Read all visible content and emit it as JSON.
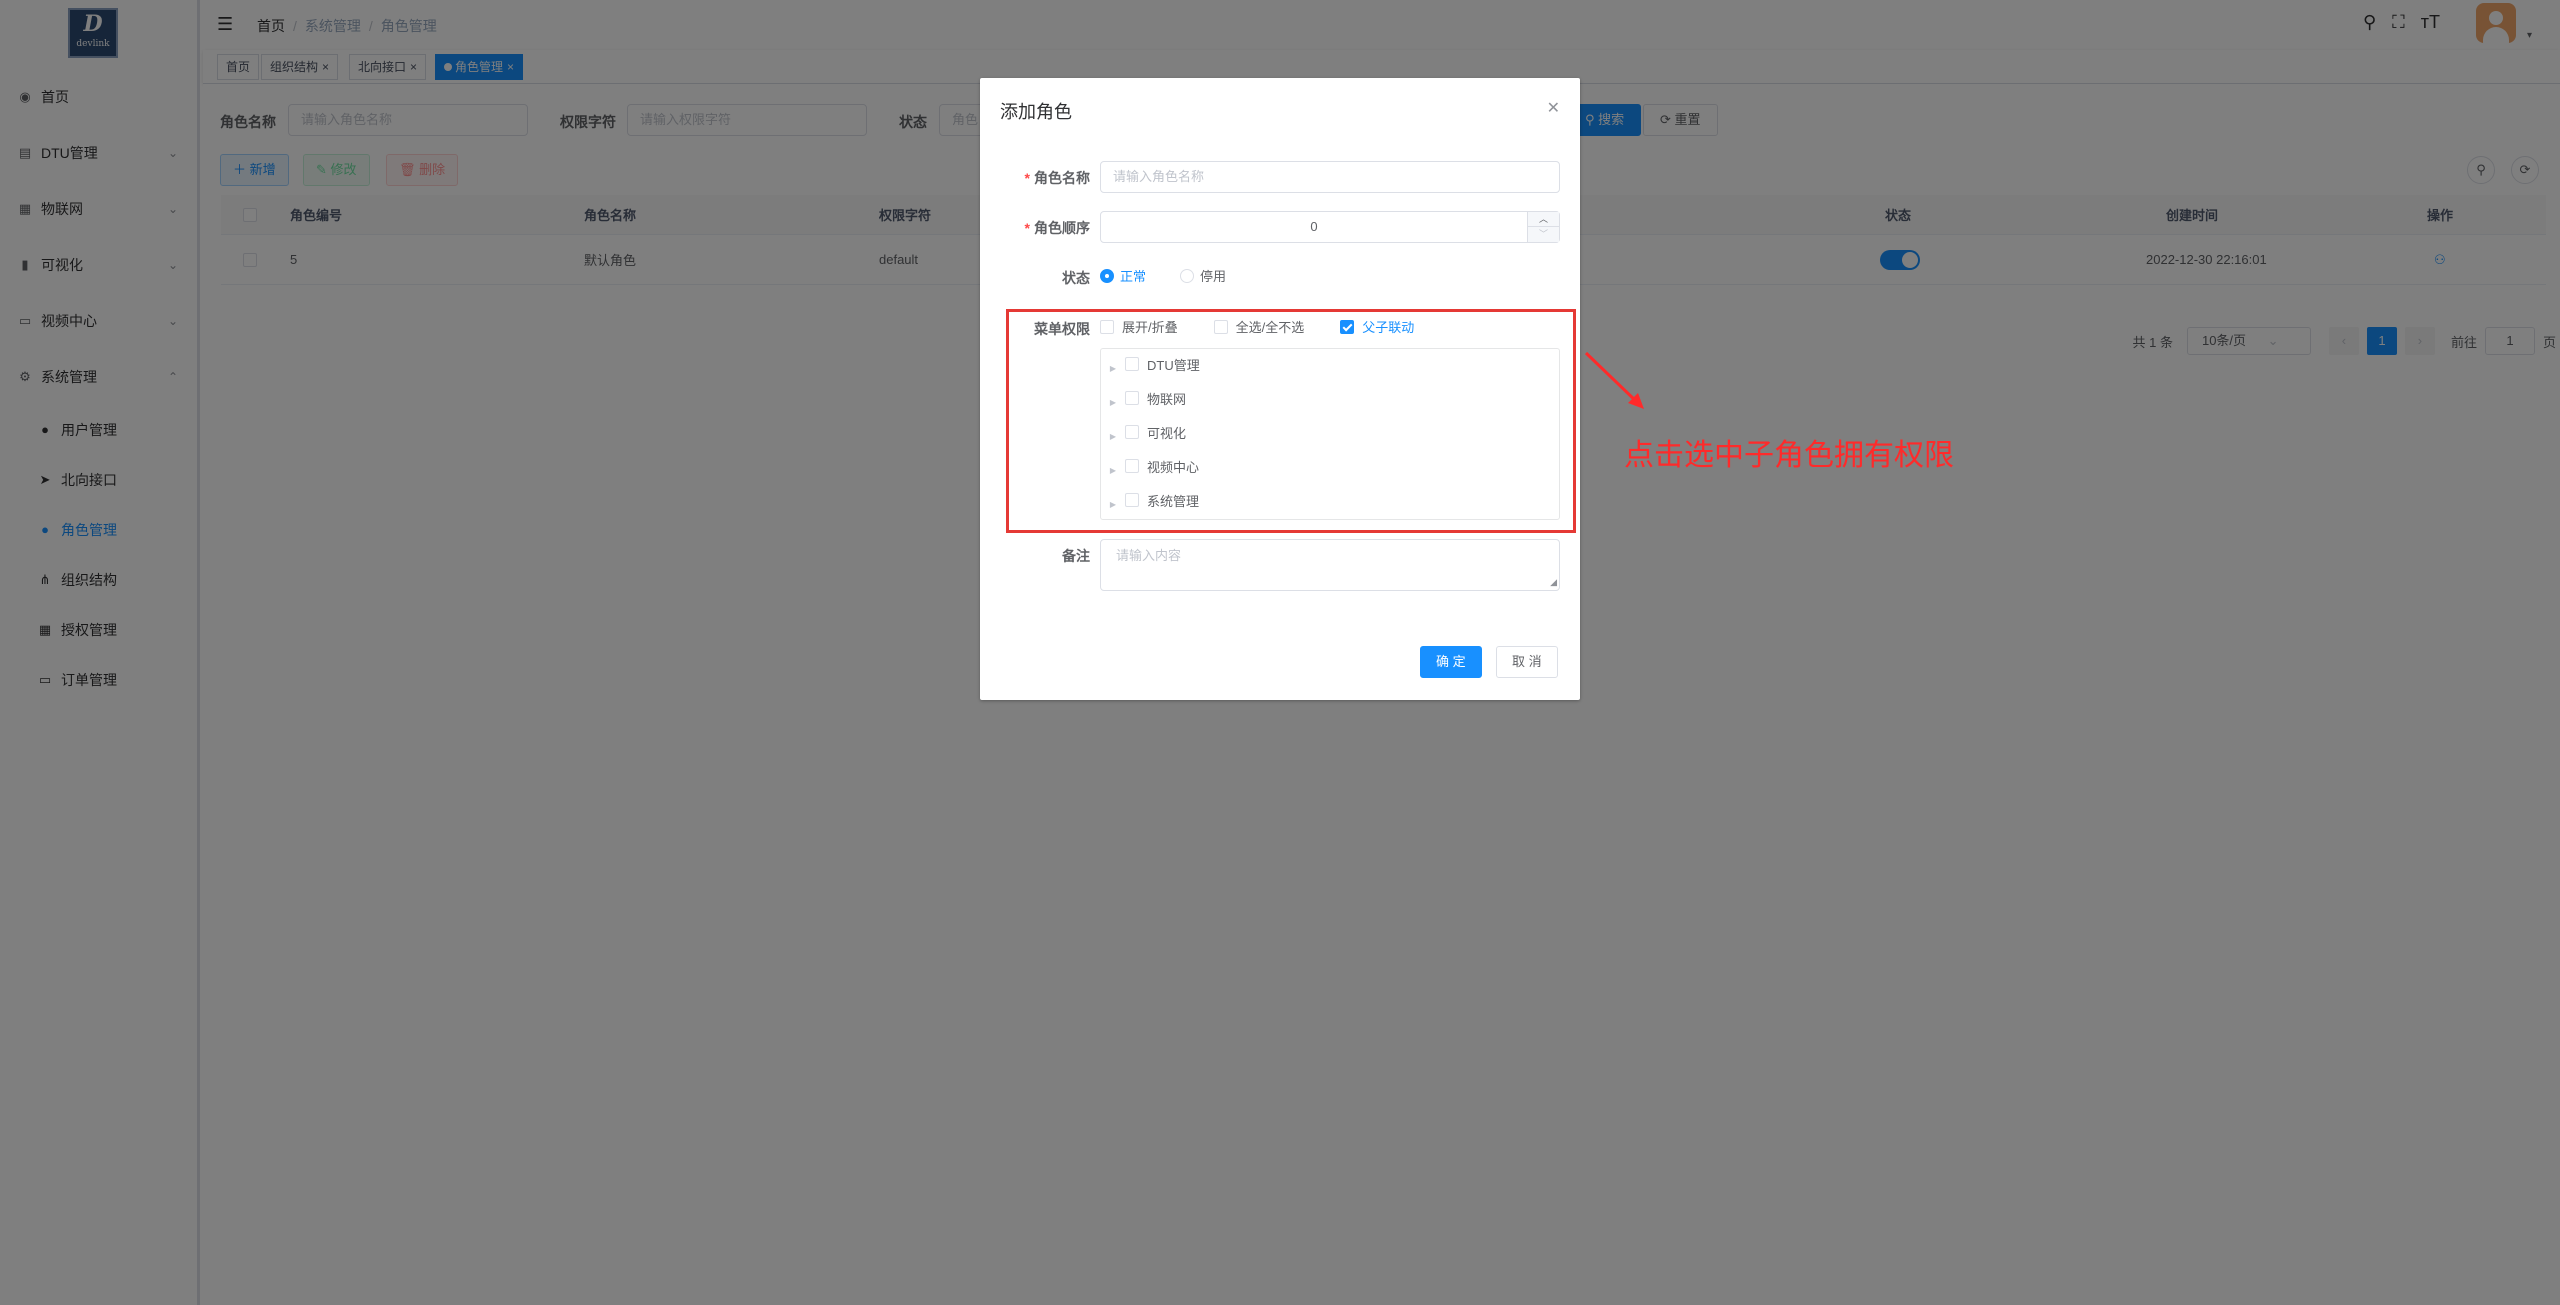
{
  "logo": {
    "big": "D",
    "small": "devlink"
  },
  "sidebar": {
    "items": [
      {
        "label": "首页",
        "icon": "dashboard-icon",
        "glyph": "◉"
      },
      {
        "label": "DTU管理",
        "icon": "dtu-icon",
        "glyph": "▤"
      },
      {
        "label": "物联网",
        "icon": "iot-icon",
        "glyph": "▦"
      },
      {
        "label": "可视化",
        "icon": "chart-icon",
        "glyph": "▮"
      },
      {
        "label": "视频中心",
        "icon": "monitor-icon",
        "glyph": "▭"
      },
      {
        "label": "系统管理",
        "icon": "gear-icon",
        "glyph": "⚙"
      }
    ],
    "subitems": [
      {
        "label": "用户管理",
        "icon": "user-icon",
        "glyph": "●"
      },
      {
        "label": "北向接口",
        "icon": "send-icon",
        "glyph": "➤"
      },
      {
        "label": "角色管理",
        "icon": "peoples-icon",
        "glyph": "●"
      },
      {
        "label": "组织结构",
        "icon": "tree-icon",
        "glyph": "⋔"
      },
      {
        "label": "授权管理",
        "icon": "grid-icon",
        "glyph": "▦"
      },
      {
        "label": "订单管理",
        "icon": "order-icon",
        "glyph": "▭"
      }
    ]
  },
  "breadcrumb": {
    "home": "首页",
    "level1": "系统管理",
    "level2": "角色管理"
  },
  "tags": [
    {
      "label": "首页"
    },
    {
      "label": "组织结构"
    },
    {
      "label": "北向接口"
    },
    {
      "label": "角色管理"
    }
  ],
  "search": {
    "role_name_label": "角色名称",
    "role_name_placeholder": "请输入角色名称",
    "perm_label": "权限字符",
    "perm_placeholder": "请输入权限字符",
    "status_label": "状态",
    "status_placeholder": "角色",
    "search_btn": "搜索",
    "reset_btn": "重置"
  },
  "toolbar": {
    "add": "新增",
    "edit": "修改",
    "delete": "删除"
  },
  "table": {
    "headers": {
      "id": "角色编号",
      "name": "角色名称",
      "perm": "权限字符",
      "status": "状态",
      "created": "创建时间",
      "ops": "操作"
    },
    "rows": [
      {
        "id": "5",
        "name": "默认角色",
        "perm": "default",
        "created": "2022-12-30 22:16:01"
      }
    ]
  },
  "pager": {
    "total": "共 1 条",
    "size": "10条/页",
    "prev": "‹",
    "page": "1",
    "next": "›",
    "goto": "前往",
    "goto_val": "1",
    "unit": "页"
  },
  "dialog": {
    "title": "添加角色",
    "name_label": "角色名称",
    "name_placeholder": "请输入角色名称",
    "order_label": "角色顺序",
    "order_value": "0",
    "status_label": "状态",
    "status_normal": "正常",
    "status_disabled": "停用",
    "menu_label": "菜单权限",
    "expand": "展开/折叠",
    "select_all": "全选/全不选",
    "linkage": "父子联动",
    "tree": [
      "DTU管理",
      "物联网",
      "可视化",
      "视频中心",
      "系统管理"
    ],
    "remark_label": "备注",
    "remark_placeholder": "请输入内容",
    "confirm": "确 定",
    "cancel": "取 消"
  },
  "annotation": {
    "text": "点击选中子角色拥有权限"
  },
  "colors": {
    "primary": "#1890ff",
    "danger": "#e53935",
    "overlay": "rgba(0,0,0,0.5)"
  }
}
